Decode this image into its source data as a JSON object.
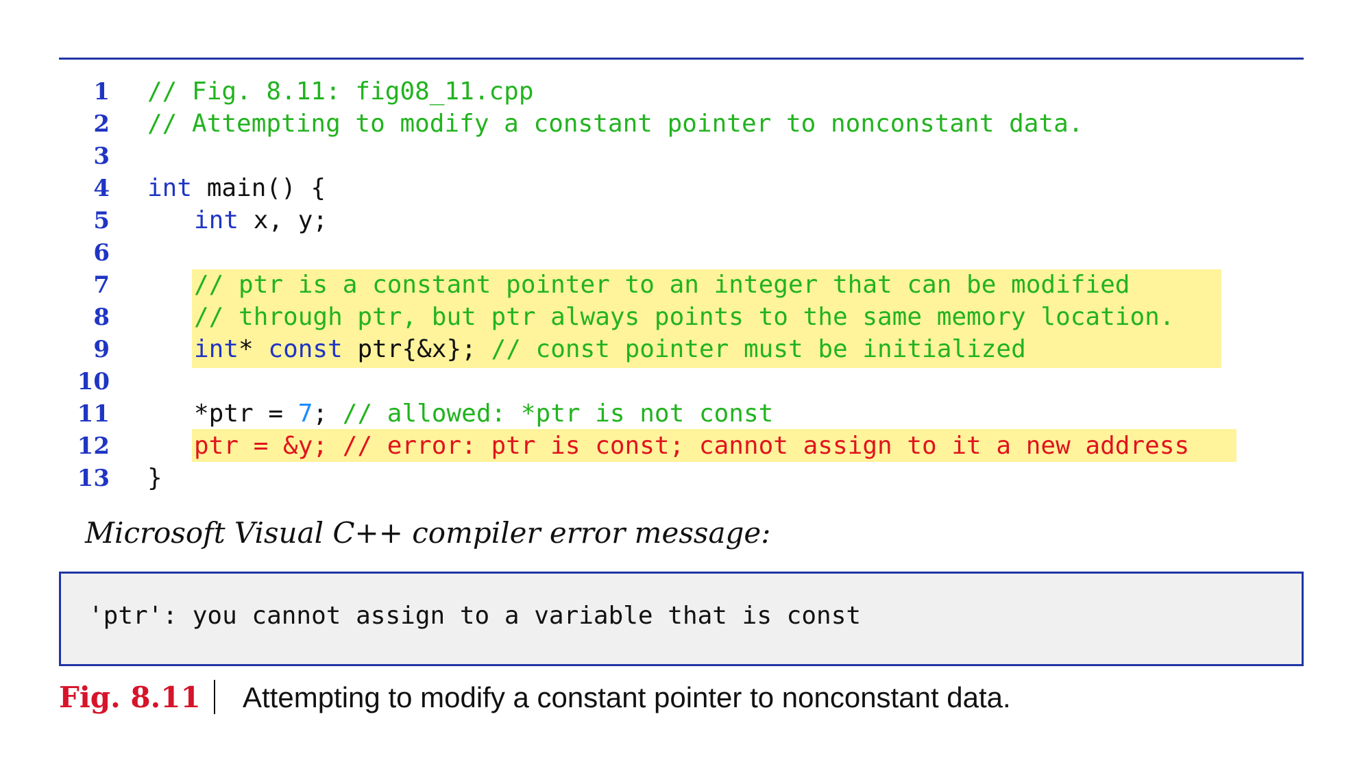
{
  "code_listing": {
    "lines": [
      {
        "number": "1",
        "segments": [
          {
            "text": "// Fig. 8.11: fig08_11.cpp",
            "role": "comment"
          }
        ]
      },
      {
        "number": "2",
        "segments": [
          {
            "text": "// Attempting to modify a constant pointer to nonconstant data.",
            "role": "comment"
          }
        ]
      },
      {
        "number": "3",
        "segments": []
      },
      {
        "number": "4",
        "segments": [
          {
            "text": "int",
            "role": "keyword"
          },
          {
            "text": " main() {",
            "role": "plain"
          }
        ]
      },
      {
        "number": "5",
        "segments": [
          {
            "text": "int",
            "role": "keyword"
          },
          {
            "text": " x, y;",
            "role": "plain"
          }
        ]
      },
      {
        "number": "6",
        "segments": []
      },
      {
        "number": "7",
        "segments": [
          {
            "text": "// ptr is a constant pointer to an integer that can be modified",
            "role": "comment"
          }
        ]
      },
      {
        "number": "8",
        "segments": [
          {
            "text": "// through ptr, but ptr always points to the same memory location.",
            "role": "comment"
          }
        ]
      },
      {
        "number": "9",
        "segments": [
          {
            "text": "int",
            "role": "keyword"
          },
          {
            "text": "* ",
            "role": "plain"
          },
          {
            "text": "const",
            "role": "keyword"
          },
          {
            "text": " ptr{&x}; ",
            "role": "plain"
          },
          {
            "text": "// const pointer must be initialized",
            "role": "comment"
          }
        ]
      },
      {
        "number": "10",
        "segments": []
      },
      {
        "number": "11",
        "segments": [
          {
            "text": "*ptr = ",
            "role": "plain"
          },
          {
            "text": "7",
            "role": "number"
          },
          {
            "text": "; ",
            "role": "plain"
          },
          {
            "text": "// allowed: *ptr is not const",
            "role": "comment"
          }
        ]
      },
      {
        "number": "12",
        "segments": [
          {
            "text": "ptr = &y; // error: ptr is const; cannot assign to it a new address",
            "role": "error"
          }
        ]
      },
      {
        "number": "13",
        "segments": [
          {
            "text": "}",
            "role": "plain"
          }
        ]
      }
    ]
  },
  "compiler_output": {
    "heading": "Microsoft Visual C++ compiler error message:",
    "message": "'ptr': you cannot assign to a variable that is const"
  },
  "figure": {
    "label": "Fig. 8.11",
    "title": "Attempting to modify a constant pointer to nonconstant data."
  },
  "colors": {
    "comment": "#22b31f",
    "keyword": "#1f35c4",
    "number": "#1a8cff",
    "error": "#e0141e",
    "highlight": "#fff39b",
    "rule": "#1f35a6",
    "caption_label": "#d6142a"
  }
}
